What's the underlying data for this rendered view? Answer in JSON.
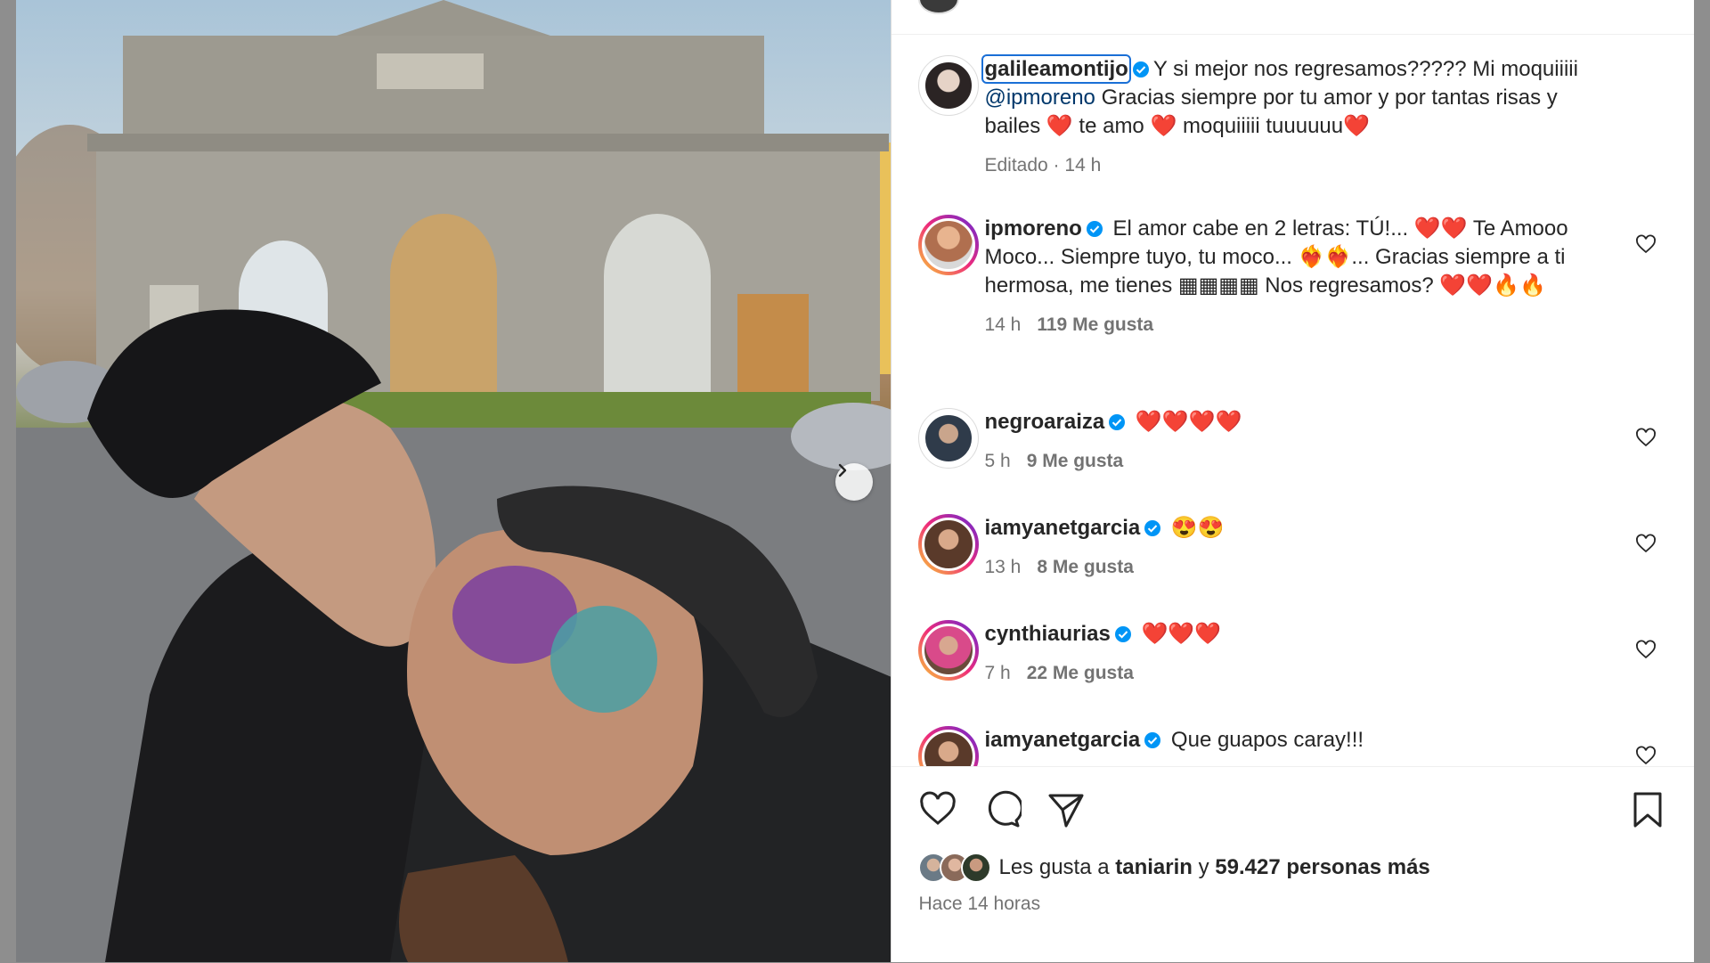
{
  "post": {
    "author": "galileamontijo",
    "caption_part1": "Y si mejor nos regresamos????? Mi moquiiiii",
    "caption_mention": "@ipmoreno",
    "caption_part2": "Gracias siempre por tu amor y por tantas risas y bailes ❤️ te amo ❤️ moquiiiii tuuuuuu❤️",
    "edited_label": "Editado",
    "edited_time": "14 h"
  },
  "comments": [
    {
      "user": "ipmoreno",
      "text": "El amor cabe en 2 letras: TÚ!... ❤️❤️ Te Amooo Moco... Siempre tuyo, tu moco... ❤️‍🔥❤️‍🔥... Gracias siempre a ti hermosa, me tienes ▦▦▦▦ Nos regresamos? ❤️❤️🔥🔥",
      "time": "14 h",
      "likes": "119 Me gusta"
    },
    {
      "user": "negroaraiza",
      "text": "❤️❤️❤️❤️",
      "time": "5 h",
      "likes": "9 Me gusta"
    },
    {
      "user": "iamyanetgarcia",
      "text": "😍😍",
      "time": "13 h",
      "likes": "8 Me gusta"
    },
    {
      "user": "cynthiaurias",
      "text": "❤️❤️❤️",
      "time": "7 h",
      "likes": "22 Me gusta"
    },
    {
      "user": "iamyanetgarcia",
      "text": "Que guapos caray!!!",
      "time": "",
      "likes": ""
    }
  ],
  "likes": {
    "prefix": "Les gusta a",
    "first_user": "taniarin",
    "connector": "y",
    "others": "59.427 personas más"
  },
  "posted": "Hace 14 horas",
  "colors": {
    "verified": "#0095f6",
    "mention": "#00376b",
    "muted": "#737373",
    "focus": "#1a6fd6"
  },
  "icons": [
    "like-icon",
    "comment-icon",
    "share-icon",
    "save-icon",
    "chevron-right-icon",
    "verified-icon",
    "heart-icon"
  ]
}
